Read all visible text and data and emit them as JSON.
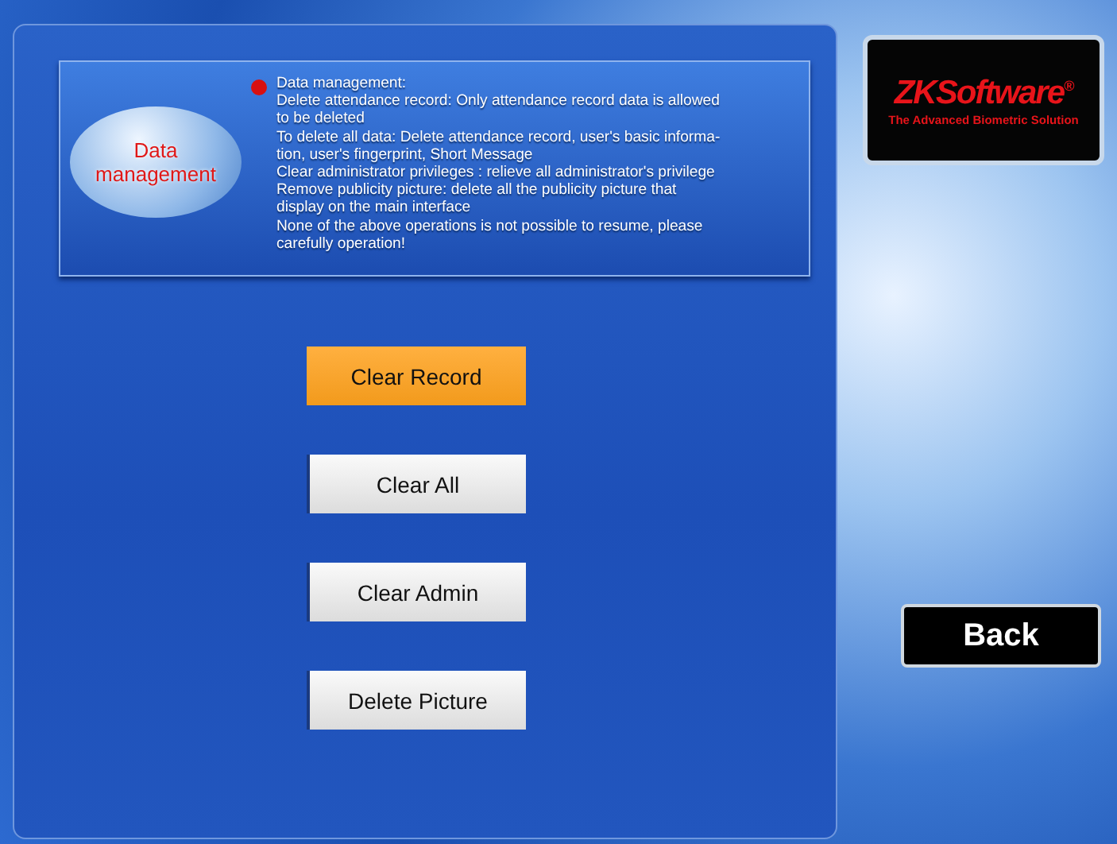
{
  "header": {
    "bubble": "Data management",
    "lines": [
      "Data management:",
      "Delete attendance record: Only attendance record data is allowed",
      "to be deleted",
      "To delete all data: Delete attendance record, user's basic informa-",
      "tion, user's fingerprint, Short Message",
      "Clear administrator privileges  :  relieve all administrator's privilege",
      "Remove publicity picture: delete all the publicity picture that",
      "display on the main interface",
      "None of the above operations is not possible to resume, please",
      "carefully operation!"
    ]
  },
  "buttons": [
    {
      "label": "Clear Record",
      "selected": true
    },
    {
      "label": "Clear All",
      "selected": false
    },
    {
      "label": "Clear Admin",
      "selected": false
    },
    {
      "label": "Delete Picture",
      "selected": false
    }
  ],
  "logo": {
    "name": "ZKSoftware",
    "mark": "®",
    "tagline": "The Advanced Biometric Solution"
  },
  "back": "Back"
}
